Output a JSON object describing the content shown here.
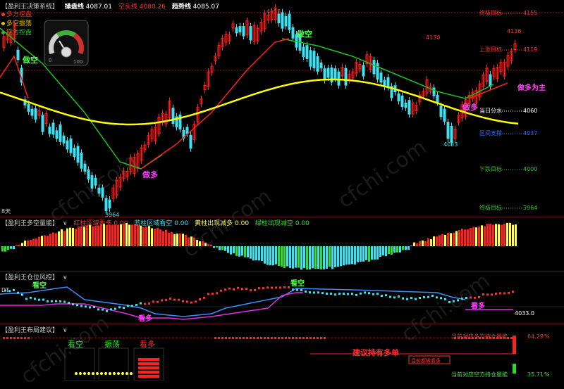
{
  "header": {
    "title": "【盈利王决策系统】",
    "op_label": "操盘线",
    "op_value": "4087.01",
    "kong_label": "空头线",
    "kong_value": "4080.26",
    "trend_label": "趋势线",
    "trend_value": "4085.07"
  },
  "legend": {
    "items": [
      {
        "label": "多方控盘",
        "color": "#ff3030"
      },
      {
        "label": "多空振荡",
        "color": "#e0c000"
      },
      {
        "label": "空方控盘",
        "color": "#30c030"
      }
    ]
  },
  "gauge": {
    "min_label": "0",
    "max_label": "100",
    "needle_value": 45
  },
  "main_chart": {
    "price_labels": {
      "high1": "4155",
      "high2": "4130",
      "high3": "4136",
      "low1": "3964",
      "low2": "4033"
    },
    "signals": {
      "s1": "做空",
      "s2": "做多",
      "s3": "做空",
      "s4": "做多",
      "s5": "做多为主"
    },
    "right_levels": [
      {
        "label": "终极目标",
        "value": "4155",
        "color": "#ff3030"
      },
      {
        "label": "上涨目标",
        "value": "4119",
        "color": "#ff3030"
      },
      {
        "label": "当日分水",
        "value": "4060",
        "color": "#ffffff"
      },
      {
        "label": "区间支撑",
        "value": "4037",
        "color": "#3070ff"
      },
      {
        "label": "下跌目标",
        "value": "4000",
        "color": "#30c030"
      },
      {
        "label": "终极目标",
        "value": "3964",
        "color": "#30c030"
      }
    ],
    "period": "8天"
  },
  "panel2": {
    "title": "【盈利王多空量能】",
    "red_label": "红柱区域看多",
    "red_value": "0.00",
    "blue_label": "蓝柱区域看空",
    "blue_value": "0.00",
    "yellow_label": "黄柱出现减多",
    "yellow_value": "0.00",
    "green_label": "绿柱出现减空",
    "green_value": "0.00"
  },
  "panel3": {
    "title": "【盈利王仓位风控】",
    "left_label": "DT",
    "signal_kong": "看空",
    "signal_duo": "看多",
    "signal_kong2": "看空",
    "signal_duo2": "看多",
    "value": "4033.0"
  },
  "panel4": {
    "title": "【盈利王布局建议】",
    "opt_kong": "看空",
    "opt_zhendang": "振荡",
    "opt_duo": "看多",
    "advice": "建议持有多单",
    "duo_position_label": "当前对应多方持仓量能",
    "duo_position_value": "64.29",
    "kong_position_label": "当前对应空方持仓量能",
    "kong_position_value": "35.71",
    "percent_unit": "%",
    "tag": "目前都做看多"
  },
  "watermark": "cfchi.com",
  "colors": {
    "up": "#ff2020",
    "down": "#40e0f0",
    "trend": "#ffff00",
    "ma_red": "#ff2020",
    "ma_green": "#20c020"
  }
}
